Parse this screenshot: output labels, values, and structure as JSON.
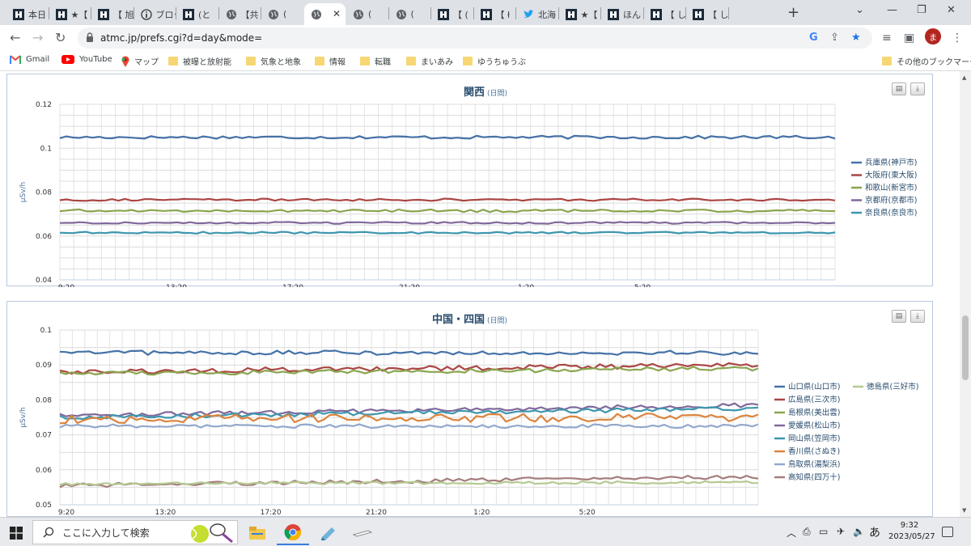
{
  "tabs": [
    {
      "title": "本日",
      "icon": "site"
    },
    {
      "title": "★【",
      "icon": "site"
    },
    {
      "title": "【 旭",
      "icon": "site"
    },
    {
      "title": "ブロク",
      "icon": "info"
    },
    {
      "title": "(と",
      "icon": "site"
    },
    {
      "title": "【共",
      "icon": "globe"
    },
    {
      "title": "(",
      "icon": "globe"
    },
    {
      "title": "",
      "icon": "globe",
      "active": true
    },
    {
      "title": "(",
      "icon": "globe"
    },
    {
      "title": "(",
      "icon": "globe"
    },
    {
      "title": "【 (",
      "icon": "site"
    },
    {
      "title": "【 ł",
      "icon": "site"
    },
    {
      "title": "北海",
      "icon": "twitter"
    },
    {
      "title": "★【",
      "icon": "site"
    },
    {
      "title": "ほん",
      "icon": "site"
    },
    {
      "title": "【 し",
      "icon": "site"
    },
    {
      "title": "【 し",
      "icon": "site"
    }
  ],
  "new_tab_label": "+",
  "window": {
    "dropdown": "⌄",
    "minimize": "—",
    "restore": "❐",
    "close": "✕"
  },
  "url": "atmc.jp/prefs.cgi?d=day&mode=",
  "avatar_letter": "ま",
  "bookmarks": [
    {
      "label": "Gmail",
      "icon": "gmail-icon"
    },
    {
      "label": "YouTube",
      "icon": "youtube-icon"
    },
    {
      "label": "マップ",
      "icon": "maps-icon"
    },
    {
      "label": "被曝と放射能",
      "icon": "folder-icon"
    },
    {
      "label": "気象と地象",
      "icon": "folder-icon"
    },
    {
      "label": "情報",
      "icon": "folder-icon"
    },
    {
      "label": "転職",
      "icon": "folder-icon"
    },
    {
      "label": "まいあみ",
      "icon": "folder-icon"
    },
    {
      "label": "ゆうちゅうぶ",
      "icon": "folder-icon"
    }
  ],
  "other_bookmarks": "その他のブックマーク",
  "chart_data": [
    {
      "type": "line",
      "title": "関西",
      "subtitle": "(日間)",
      "ylabel": "μSv/h",
      "ylim": [
        0.04,
        0.12
      ],
      "yticks": [
        "0.04",
        "0.06",
        "0.08",
        "0.1",
        "0.12"
      ],
      "xticks": [
        "9:20",
        "13:20",
        "17:20",
        "21:20",
        "1:20",
        "5:20"
      ],
      "grid": true,
      "legend": "right",
      "series": [
        {
          "name": "兵庫県(神戸市)",
          "color": "#4572a7",
          "mean": 0.105,
          "amp": 0.0007
        },
        {
          "name": "大阪府(東大阪)",
          "color": "#aa4643",
          "mean": 0.0765,
          "amp": 0.0005
        },
        {
          "name": "和歌山(新宮市)",
          "color": "#89a54e",
          "mean": 0.0715,
          "amp": 0.0006
        },
        {
          "name": "京都府(京都市)",
          "color": "#80699b",
          "mean": 0.066,
          "amp": 0.0004
        },
        {
          "name": "奈良県(奈良市)",
          "color": "#3d96ae",
          "mean": 0.0615,
          "amp": 0.0004
        }
      ]
    },
    {
      "type": "line",
      "title": "中国・四国",
      "subtitle": "(日間)",
      "ylabel": "μSv/h",
      "ylim": [
        0.05,
        0.1
      ],
      "yticks": [
        "0.05",
        "0.06",
        "0.07",
        "0.08",
        "0.09",
        "0.1"
      ],
      "xticks": [
        "9:20",
        "13:20",
        "17:20",
        "21:20",
        "1:20",
        "5:20"
      ],
      "grid": true,
      "legend": "right",
      "series": [
        {
          "name": "山口県(山口市)",
          "color": "#4572a7",
          "start": 0.0935,
          "end": 0.0935,
          "amp": 0.0006
        },
        {
          "name": "広島県(三次市)",
          "color": "#aa4643",
          "start": 0.088,
          "end": 0.09,
          "amp": 0.0007
        },
        {
          "name": "島根県(美出雲)",
          "color": "#89a54e",
          "start": 0.0875,
          "end": 0.089,
          "amp": 0.0006
        },
        {
          "name": "愛媛県(松山市)",
          "color": "#80699b",
          "start": 0.0755,
          "end": 0.0785,
          "amp": 0.0006
        },
        {
          "name": "岡山県(笠岡市)",
          "color": "#3d96ae",
          "start": 0.075,
          "end": 0.0775,
          "amp": 0.0006
        },
        {
          "name": "香川県(さぬき)",
          "color": "#db843d",
          "start": 0.0745,
          "end": 0.075,
          "amp": 0.0012
        },
        {
          "name": "鳥取県(湯梨浜)",
          "color": "#92a8cd",
          "start": 0.0725,
          "end": 0.0725,
          "amp": 0.0005
        },
        {
          "name": "高知県(四万十)",
          "color": "#a47d7c",
          "start": 0.0555,
          "end": 0.058,
          "amp": 0.0006
        },
        {
          "name": "徳島県(三好市)",
          "color": "#b5ca92",
          "start": 0.056,
          "end": 0.0565,
          "amp": 0.0004
        }
      ]
    }
  ],
  "taskbar": {
    "search_placeholder": "ここに入力して検索",
    "time": "9:32",
    "date": "2023/05/27",
    "ime": "あ"
  }
}
